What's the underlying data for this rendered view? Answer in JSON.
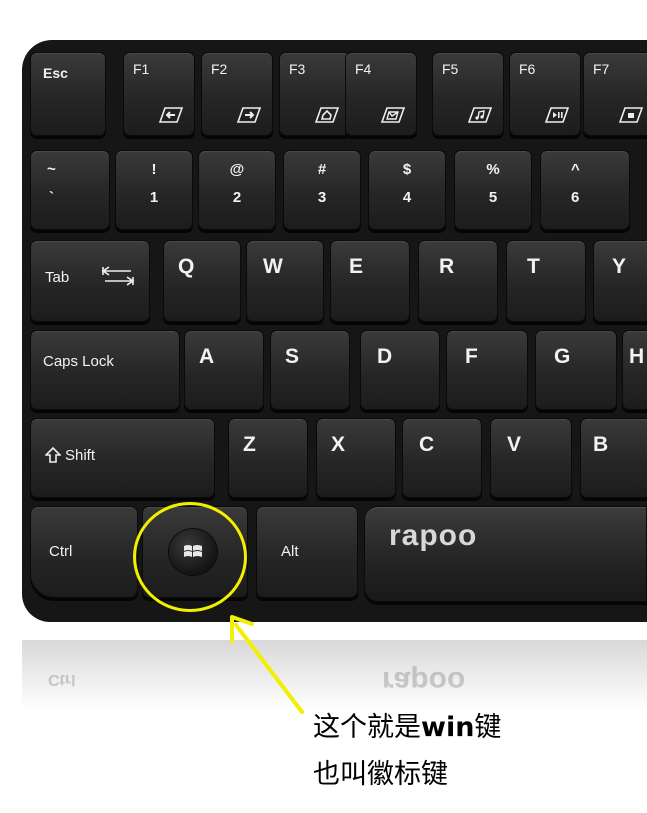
{
  "keyboard": {
    "brand": "rapoo",
    "function_row": [
      {
        "label": "Esc"
      },
      {
        "label": "F1",
        "icon": "back-arrow-icon"
      },
      {
        "label": "F2",
        "icon": "forward-arrow-icon"
      },
      {
        "label": "F3",
        "icon": "home-icon"
      },
      {
        "label": "F4",
        "icon": "mail-icon"
      },
      {
        "label": "F5",
        "icon": "music-icon"
      },
      {
        "label": "F6",
        "icon": "play-pause-icon"
      },
      {
        "label": "F7",
        "icon": "stop-icon"
      }
    ],
    "number_row": [
      {
        "shift": "~",
        "base": "`"
      },
      {
        "shift": "!",
        "base": "1"
      },
      {
        "shift": "@",
        "base": "2"
      },
      {
        "shift": "#",
        "base": "3"
      },
      {
        "shift": "$",
        "base": "4"
      },
      {
        "shift": "%",
        "base": "5"
      },
      {
        "shift": "^",
        "base": "6"
      }
    ],
    "tab_label": "Tab",
    "qwerty_row": [
      "Q",
      "W",
      "E",
      "R",
      "T",
      "Y"
    ],
    "caps_label": "Caps Lock",
    "home_row": [
      "A",
      "S",
      "D",
      "F",
      "G",
      "H"
    ],
    "shift_label": "Shift",
    "bottom_letters": [
      "Z",
      "X",
      "C",
      "V",
      "B"
    ],
    "ctrl_label": "Ctrl",
    "win_icon": "windows-logo-icon",
    "alt_label": "Alt"
  },
  "reflection": {
    "ctrl": "Ctrl",
    "brand": "rapoo"
  },
  "annotation": {
    "line1_pre": "这个就是",
    "line1_bold": "win",
    "line1_post": "键",
    "line2": "也叫徽标键",
    "highlight_color": "#f3ef00"
  }
}
